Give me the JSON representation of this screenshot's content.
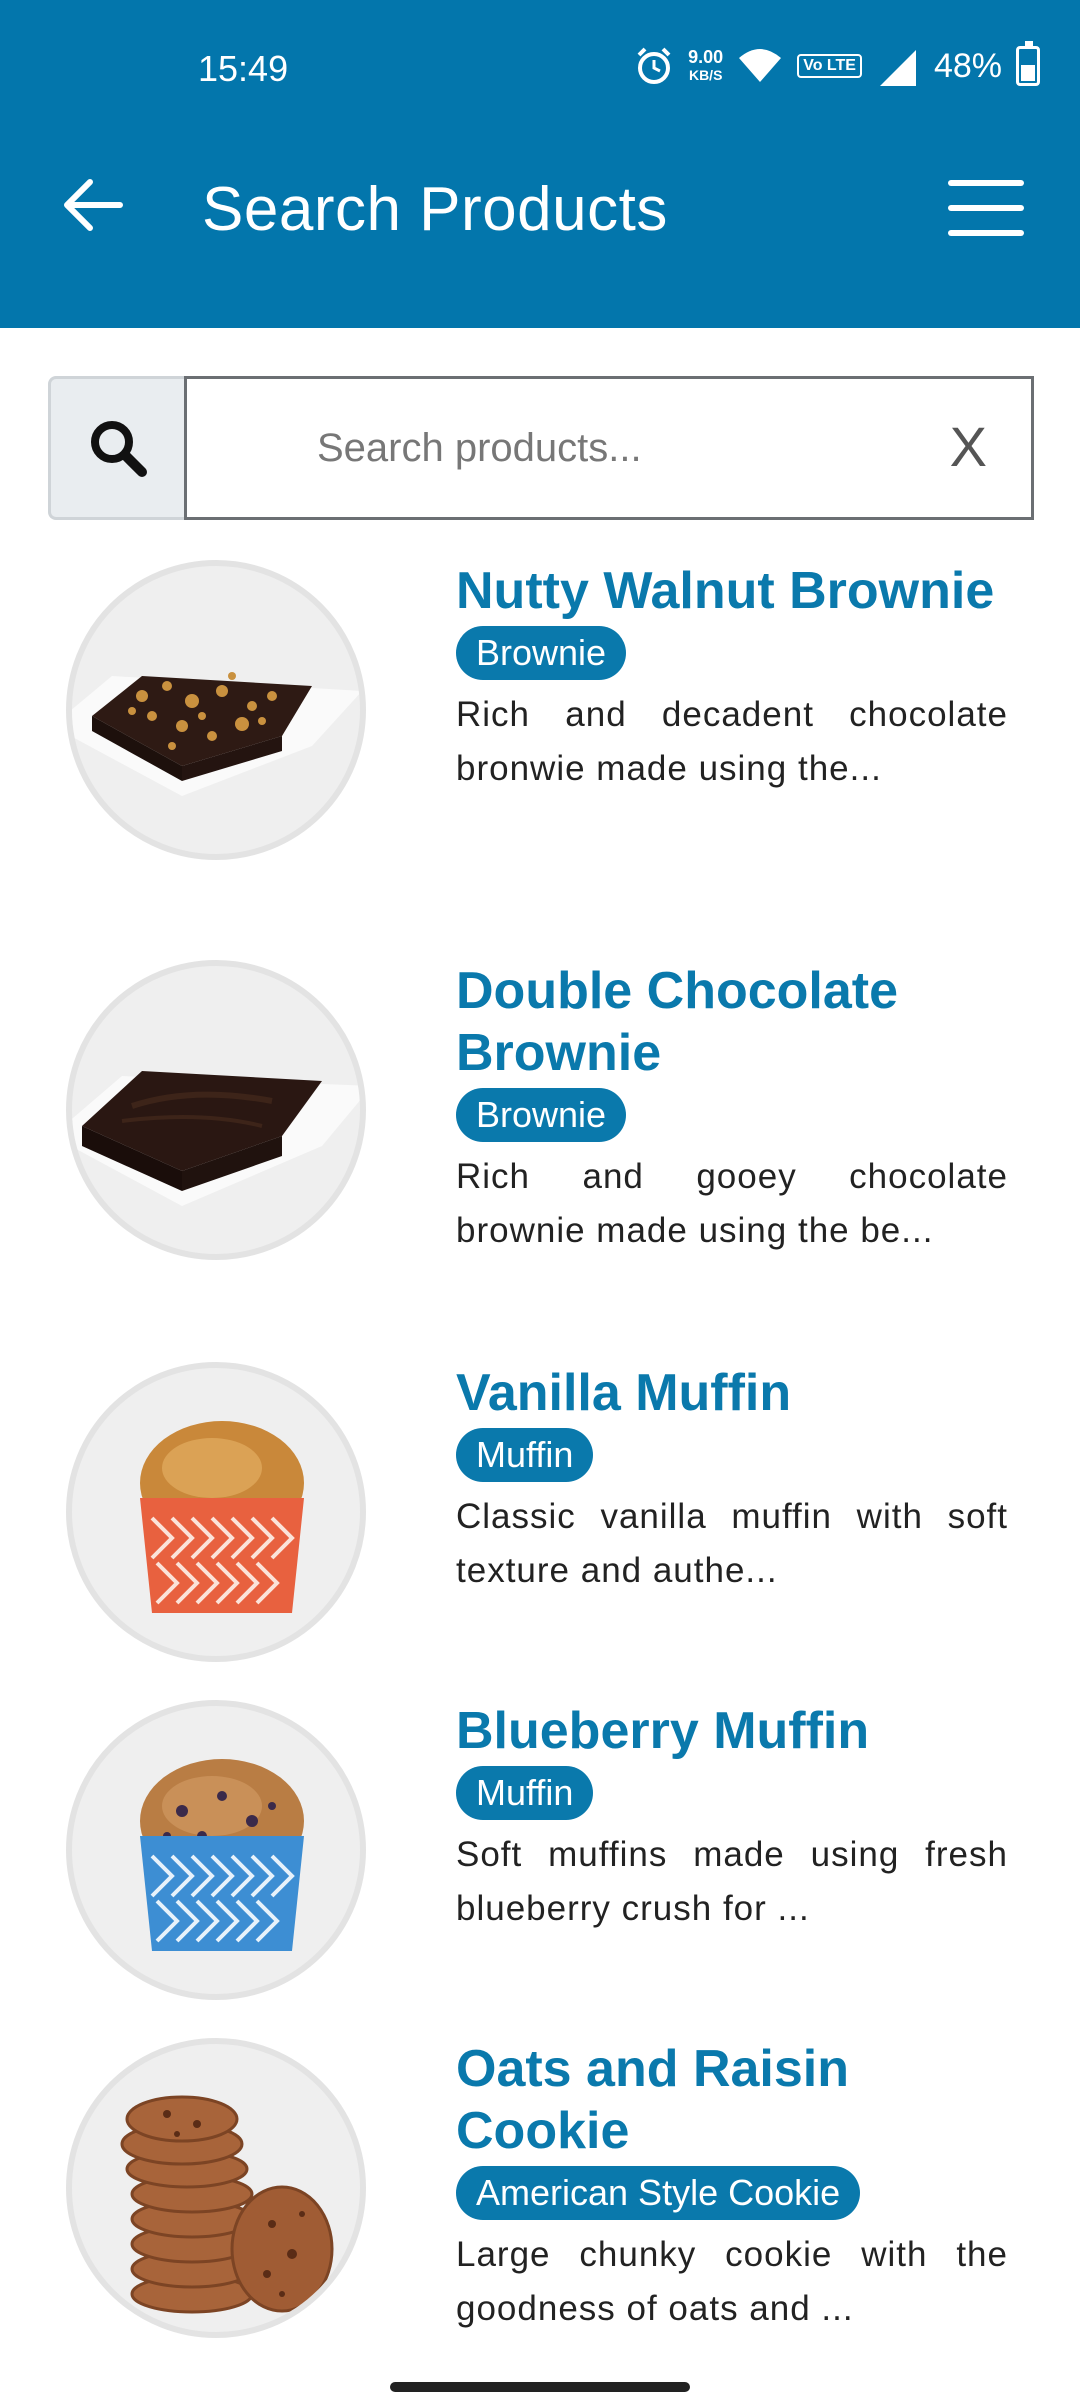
{
  "status_bar": {
    "time": "15:49",
    "speed_top": "9.00",
    "speed_bottom": "KB/S",
    "volte": "Vo LTE",
    "battery": "48%"
  },
  "header": {
    "title": "Search Products",
    "back_icon": "arrow-left-icon",
    "menu_icon": "hamburger-menu-icon"
  },
  "search": {
    "placeholder": "Search products...",
    "value": "",
    "clear_label": "X"
  },
  "products": [
    {
      "name": "Nutty Walnut Brownie",
      "category": "Brownie",
      "description": "Rich and decadent chocolate bronwie made using the...",
      "image": "walnut-brownie"
    },
    {
      "name": "Double Chocolate Brownie",
      "category": "Brownie",
      "description": "Rich and gooey chocolate brownie made using the be...",
      "image": "chocolate-brownie"
    },
    {
      "name": "Vanilla Muffin",
      "category": "Muffin",
      "description": "Classic vanilla muffin with soft texture and authe...",
      "image": "vanilla-muffin"
    },
    {
      "name": "Blueberry Muffin",
      "category": "Muffin",
      "description": "Soft muffins made using fresh blueberry crush for ...",
      "image": "blueberry-muffin"
    },
    {
      "name": "Oats and Raisin Cookie",
      "category": "American Style Cookie",
      "description": "Large chunky cookie with the goodness of oats and ...",
      "image": "oat-raisin-cookies"
    }
  ],
  "colors": {
    "brand": "#0376ac",
    "accent_text": "#0a79ac"
  }
}
